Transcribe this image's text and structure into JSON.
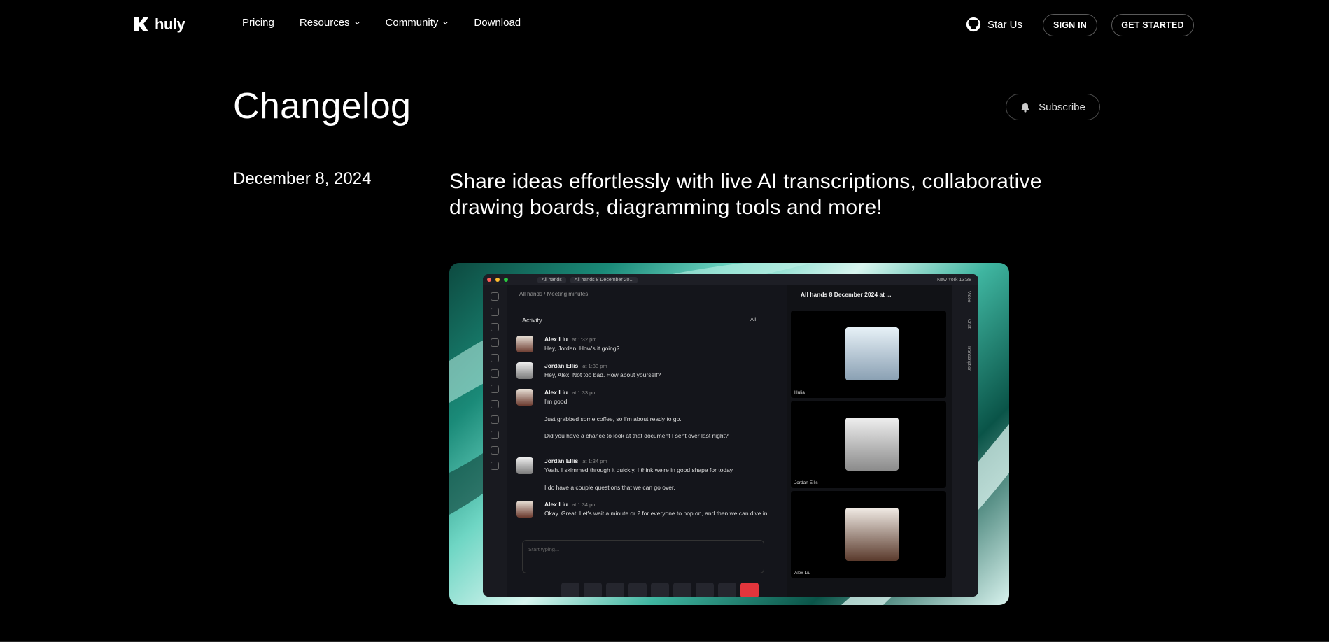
{
  "nav": {
    "logo_text": "huly",
    "links": [
      {
        "label": "Pricing",
        "has_dropdown": false
      },
      {
        "label": "Resources",
        "has_dropdown": true
      },
      {
        "label": "Community",
        "has_dropdown": true
      },
      {
        "label": "Download",
        "has_dropdown": false
      }
    ],
    "star_label": "Star Us",
    "signin_label": "SIGN IN",
    "get_started_label": "GET STARTED"
  },
  "page": {
    "title": "Changelog",
    "subscribe_label": "Subscribe",
    "entry_date": "December 8, 2024",
    "entry_headline": "Share ideas effortlessly with live AI transcriptions, collaborative drawing boards, diagramming tools and more!"
  },
  "screenshot": {
    "tab1": "All hands",
    "tab2": "All hands 8 December 20...",
    "location": "New York 13:38",
    "breadcrumb": "All hands / Meeting minutes",
    "activity_label": "Activity",
    "filter_label": "All",
    "messages": [
      {
        "author": "Alex Liu",
        "time": "at 1:32 pm",
        "text": "Hey, Jordan. How's it going?",
        "extra": []
      },
      {
        "author": "Jordan Ellis",
        "time": "at 1:33 pm",
        "text": "Hey, Alex. Not too bad. How about yourself?",
        "extra": []
      },
      {
        "author": "Alex Liu",
        "time": "at 1:33 pm",
        "text": "I'm good.",
        "extra": [
          "Just grabbed some coffee, so I'm about ready to go.",
          "Did you have a chance to look at that document I sent over last night?"
        ]
      },
      {
        "author": "Jordan Ellis",
        "time": "at 1:34 pm",
        "text": "Yeah. I skimmed through it quickly. I think we're in good shape for today.",
        "extra": [
          "I do have a couple questions that we can go over."
        ]
      },
      {
        "author": "Alex Liu",
        "time": "at 1:34 pm",
        "text": "Okay. Great. Let's wait a minute or 2 for everyone to hop on, and then we can dive in.",
        "extra": []
      }
    ],
    "composer_placeholder": "Start typing...",
    "video_title": "All hands 8 December 2024 at ...",
    "participants": [
      "Hulia",
      "Jordan Ellis",
      "Alex Liu"
    ],
    "side_labels": [
      "Video",
      "Chat",
      "Transcription"
    ]
  }
}
